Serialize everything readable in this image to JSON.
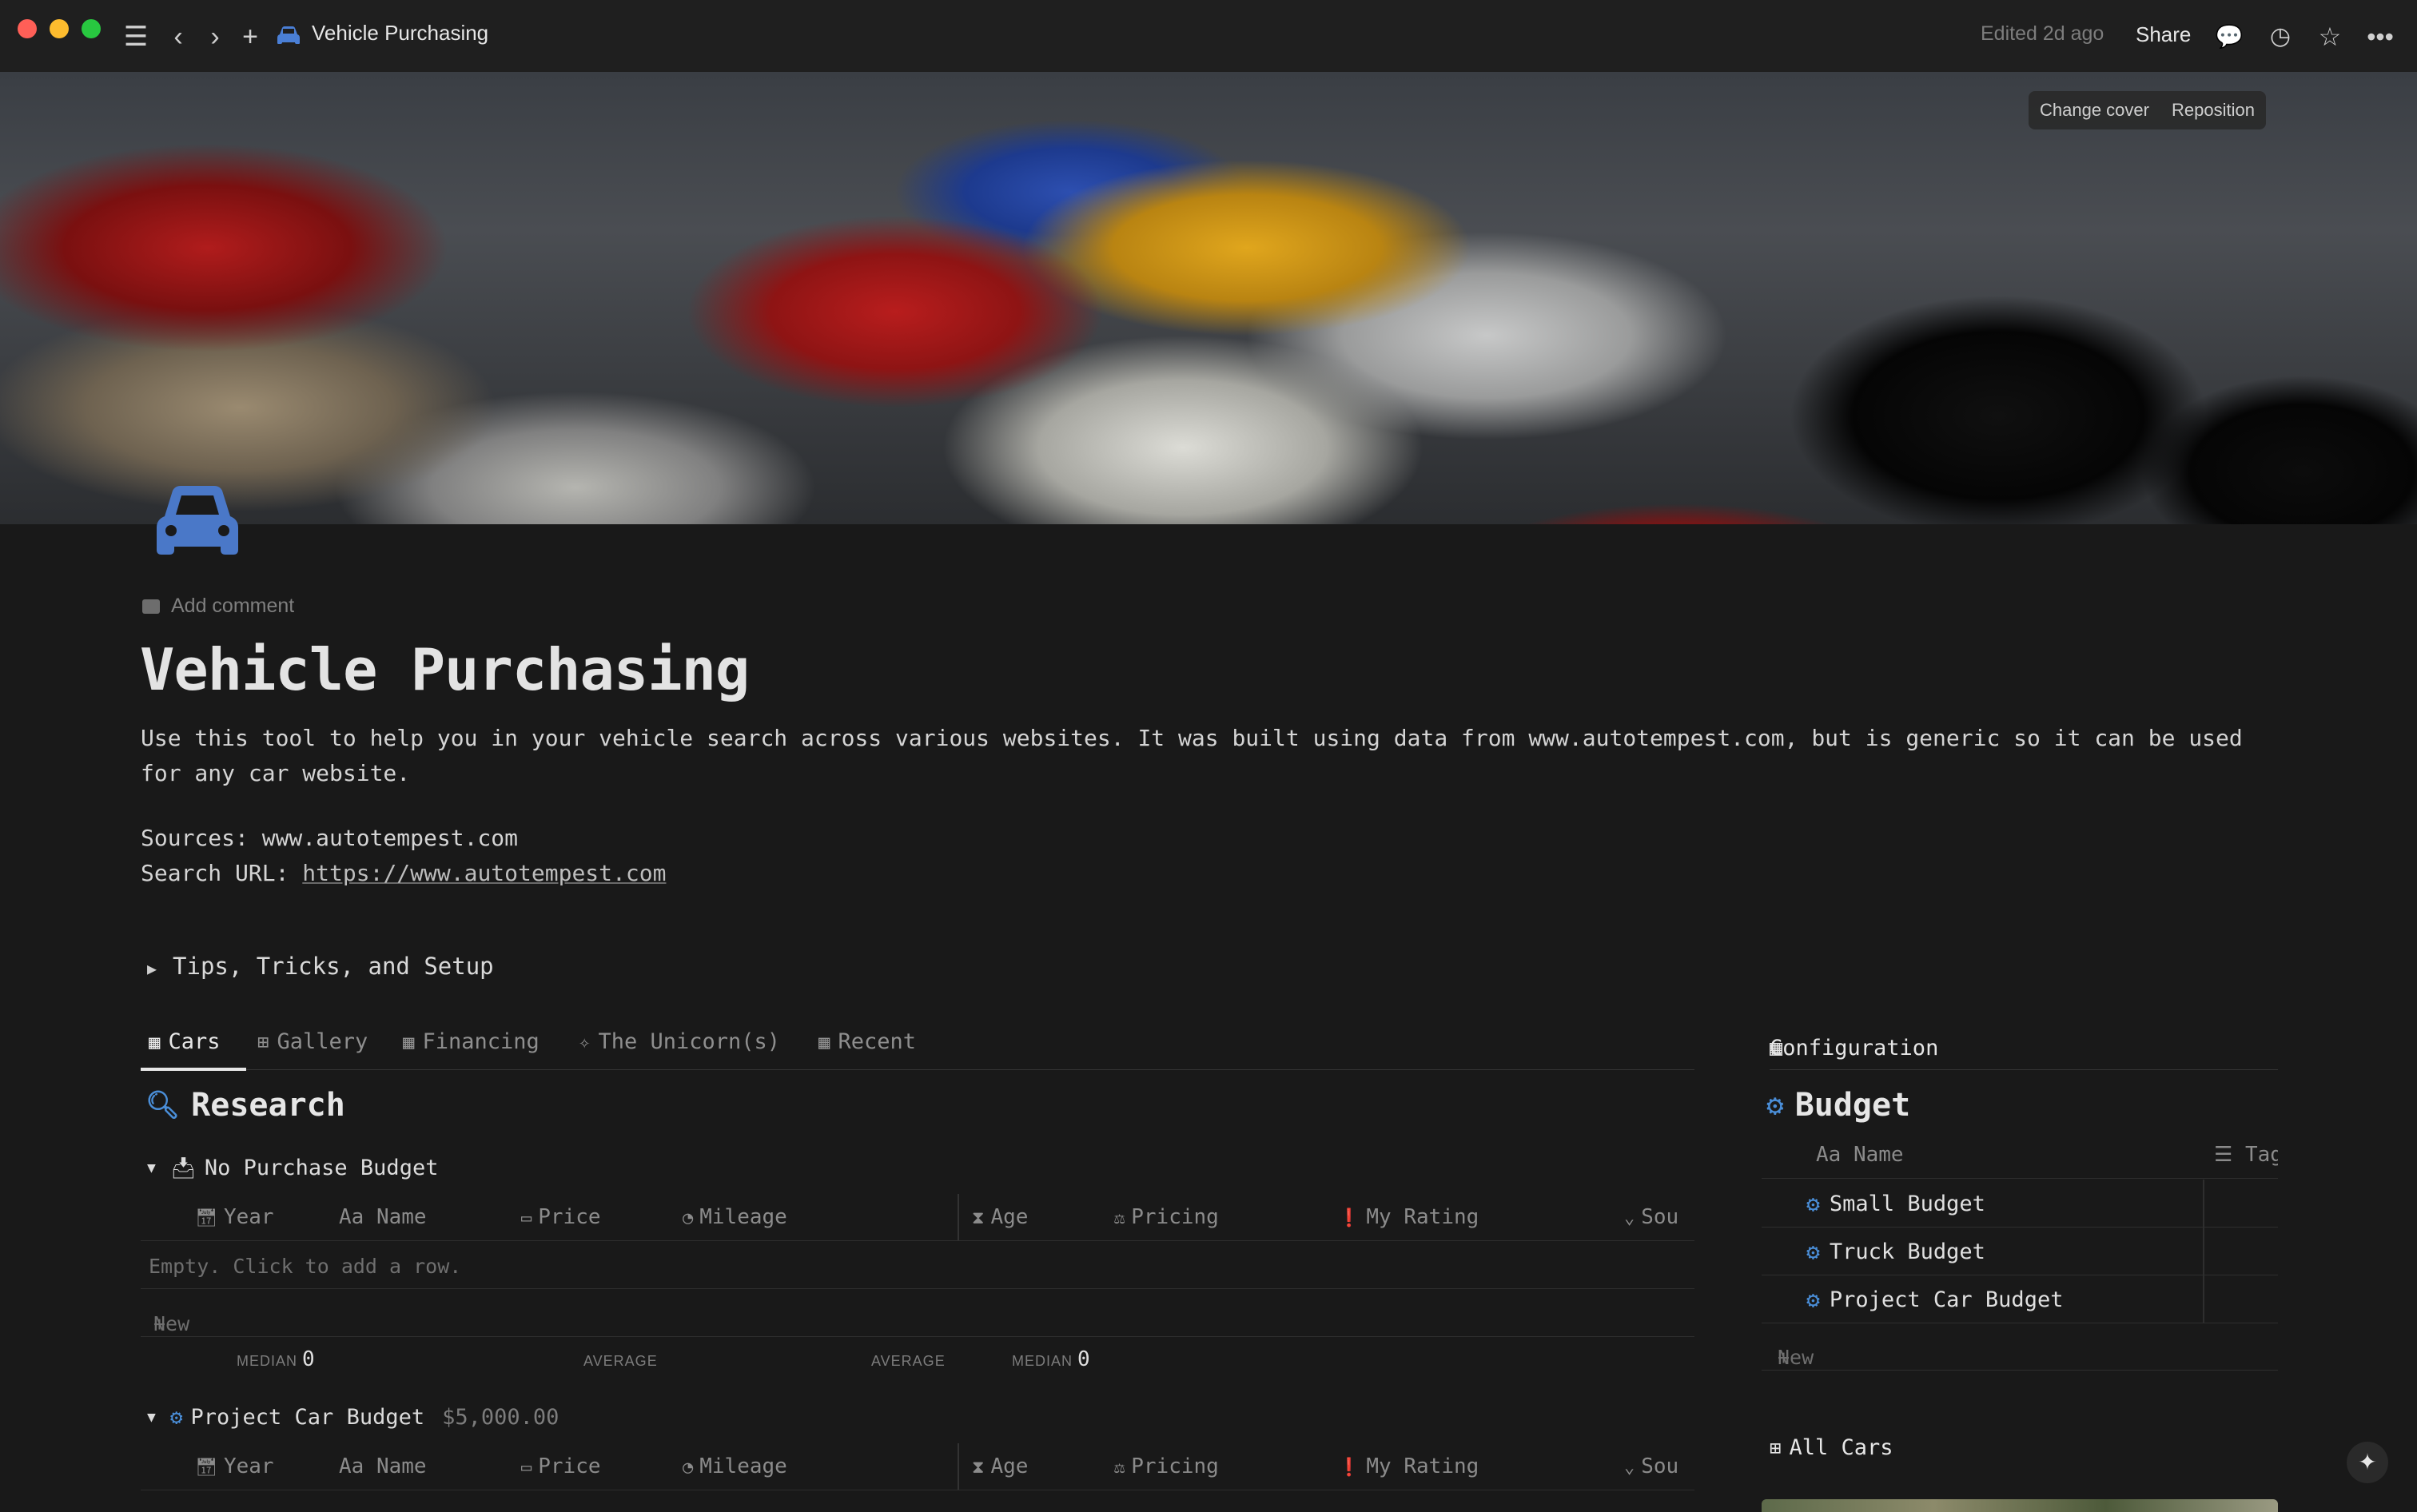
{
  "titlebar": {
    "page_title": "Vehicle Purchasing",
    "edited": "Edited 2d ago",
    "share": "Share"
  },
  "cover": {
    "change_cover": "Change cover",
    "reposition": "Reposition"
  },
  "add_comment": "Add comment",
  "title": "Vehicle Purchasing",
  "description": "Use this tool to help you in your vehicle search across various websites. It was built using data from www.autotempest.com, but is generic so it can be used for any car website.",
  "sources_label": "Sources: www.autotempest.com",
  "search_url_label": "Search URL: ",
  "search_url": "https://www.autotempest.com",
  "toggle_label": "Tips, Tricks, and Setup",
  "tabs": [
    "Cars",
    "Gallery",
    "Financing",
    "The Unicorn(s)",
    "Recent"
  ],
  "research": {
    "title": "Research",
    "columns": [
      "Year",
      "Aa Name",
      "Price",
      "Mileage",
      "Age",
      "Pricing",
      "My Rating",
      "Sou"
    ],
    "groups": [
      {
        "name": "No Purchase Budget",
        "amount": ""
      },
      {
        "name": "Project Car Budget",
        "amount": "$5,000.00"
      }
    ],
    "empty_text": "Empty. Click to add a row.",
    "new_label": "New",
    "calcs": [
      {
        "label": "MEDIAN",
        "value": "0"
      },
      {
        "label": "AVERAGE",
        "value": ""
      },
      {
        "label": "AVERAGE",
        "value": ""
      },
      {
        "label": "MEDIAN",
        "value": "0"
      }
    ]
  },
  "config": {
    "tab_label": "Configuration",
    "title": "Budget",
    "col_name": "Aa Name",
    "col_tags": "Tag",
    "rows": [
      "Small Budget",
      "Truck Budget",
      "Project Car Budget"
    ],
    "new_label": "New",
    "all_cars": "All Cars"
  },
  "colors": {
    "background": "#191919",
    "accent_blue": "#4a8ed8",
    "muted_text": "#7c7c7c"
  }
}
